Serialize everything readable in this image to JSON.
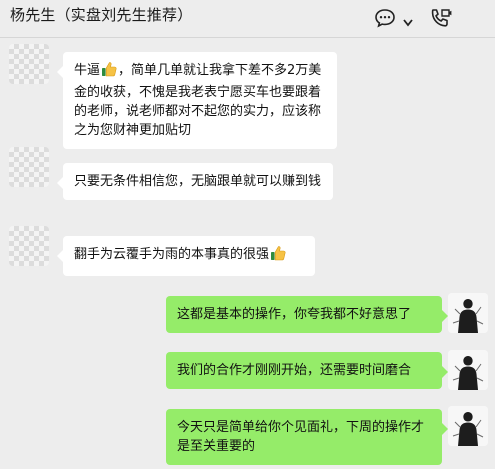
{
  "header": {
    "title": "杨先生（实盘刘先生推荐）",
    "icons": [
      "chat-bubble-icon",
      "chevron-down-icon",
      "phone-call-icon"
    ]
  },
  "messages": [
    {
      "side": "left",
      "text_before": "牛逼",
      "emoji": "thumbs-up",
      "text_after": "，简单几单就让我拿下差不多2万美金的收获，不愧是我老表宁愿买车也要跟着的老师，说老师都对不起您的实力，应该称之为您财神更加贴切"
    },
    {
      "side": "left",
      "text": "只要无条件相信您，无脑跟单就可以赚到钱"
    },
    {
      "side": "left",
      "text_before": "翻手为云覆手为雨的本事真的很强",
      "emoji": "thumbs-up",
      "text_after": ""
    },
    {
      "side": "right",
      "text": "这都是基本的操作，你夸我都不好意思了"
    },
    {
      "side": "right",
      "text": "我们的合作才刚刚开始，还需要时间磨合"
    },
    {
      "side": "right",
      "text": "今天只是简单给你个见面礼，下周的操作才是至关重要的"
    }
  ],
  "colors": {
    "background": "#ededed",
    "incoming": "#ffffff",
    "outgoing": "#95ec69"
  }
}
